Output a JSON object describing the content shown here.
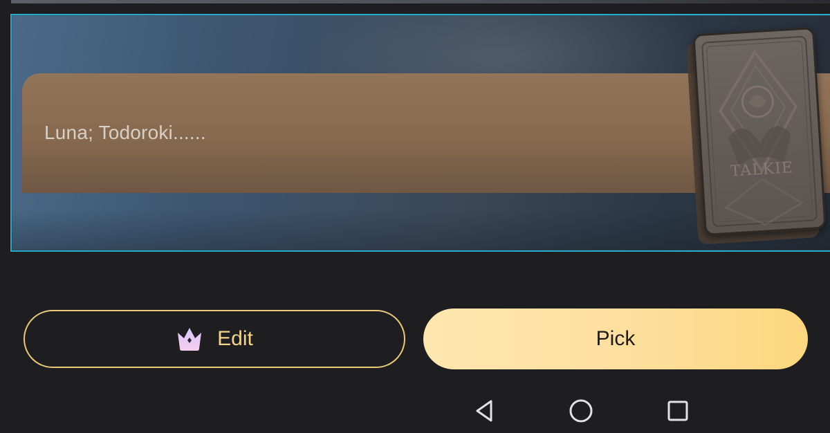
{
  "card": {
    "names": "Luna; Todoroki......",
    "card_art_label": "TALKIE"
  },
  "actions": {
    "edit_label": "Edit",
    "edit_icon": "crown-icon",
    "pick_label": "Pick"
  },
  "navigation": {
    "back_icon": "back-triangle-icon",
    "home_icon": "home-circle-icon",
    "recent_icon": "recents-square-icon"
  },
  "colors": {
    "panel_border": "#2aa8c8",
    "edit_border": "#e9c97a",
    "edit_text": "#f3d48a",
    "pick_bg": "#fdd77f",
    "background": "#1e1e21"
  }
}
